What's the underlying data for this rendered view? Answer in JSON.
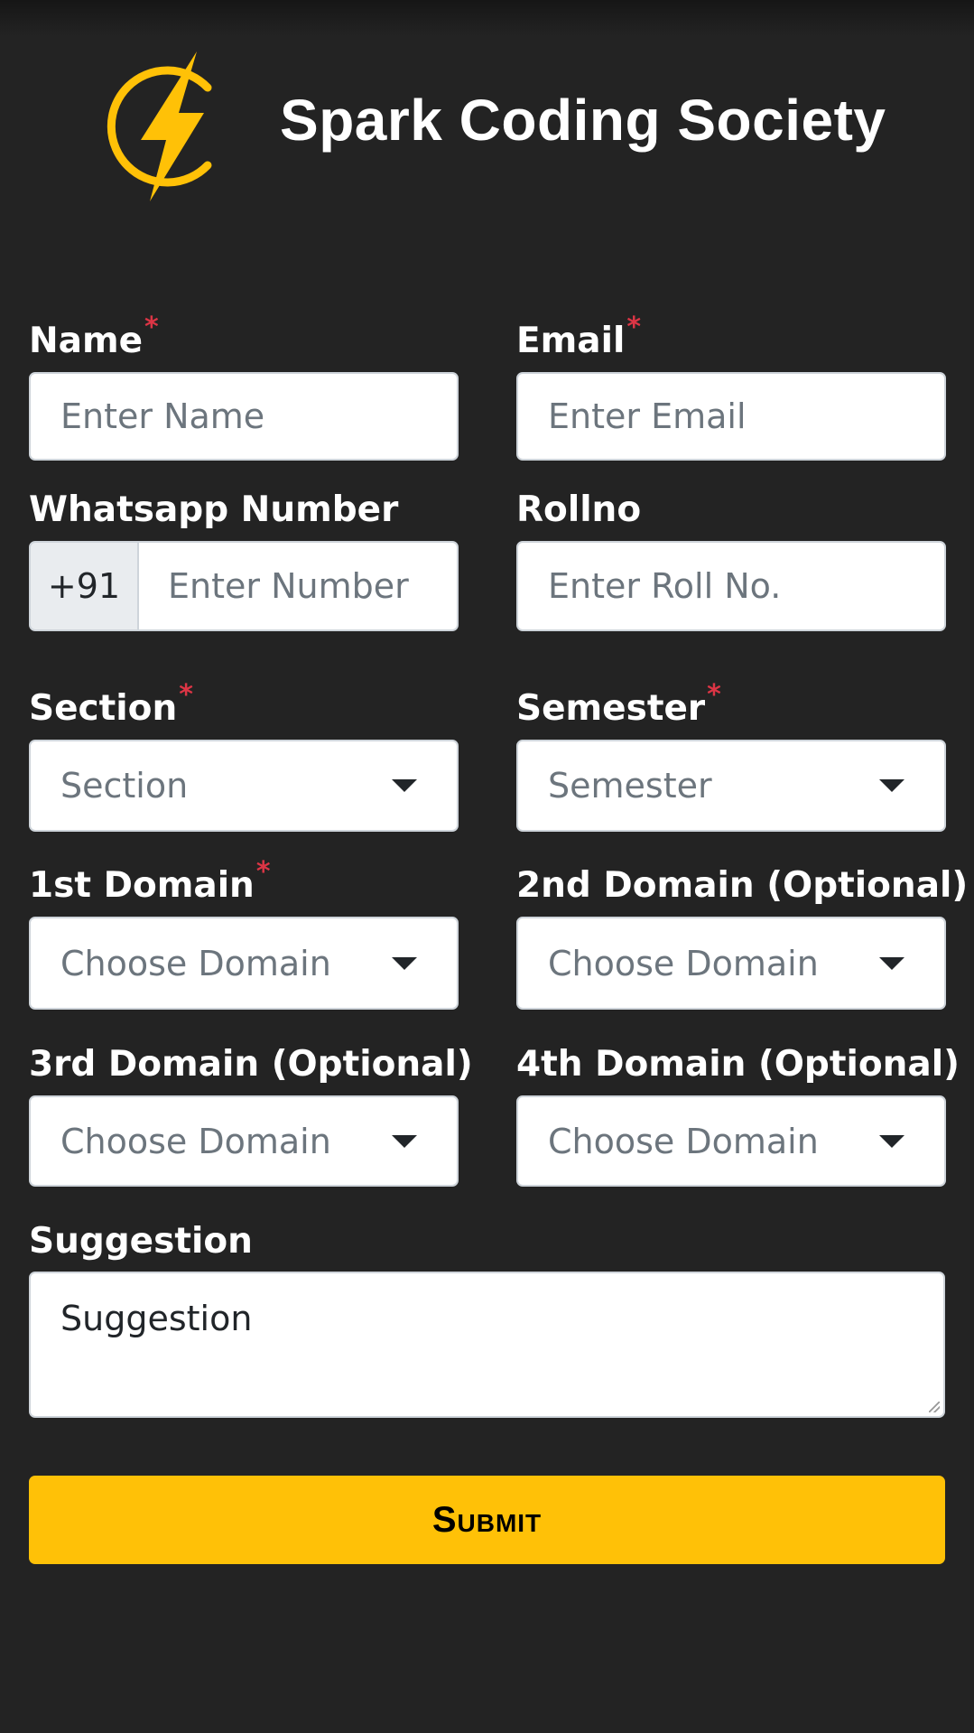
{
  "header": {
    "brand": "Spark Coding Society",
    "logo_icon": "lightning-bolt-logo-icon",
    "accent_color": "#ffc107"
  },
  "form": {
    "required_marker": "*",
    "name": {
      "label": "Name",
      "placeholder": "Enter Name"
    },
    "email": {
      "label": "Email",
      "placeholder": "Enter Email"
    },
    "whatsapp": {
      "label": "Whatsapp Number",
      "prefix": "+91",
      "placeholder": "Enter Number"
    },
    "rollno": {
      "label": "Rollno",
      "placeholder": "Enter Roll No."
    },
    "section": {
      "label": "Section",
      "selected": "Section"
    },
    "semester": {
      "label": "Semester",
      "selected": "Semester"
    },
    "domain1": {
      "label": "1st Domain",
      "selected": "Choose Domain"
    },
    "domain2": {
      "label": "2nd Domain (Optional)",
      "selected": "Choose Domain"
    },
    "domain3": {
      "label": "3rd Domain (Optional)",
      "selected": "Choose Domain"
    },
    "domain4": {
      "label": "4th Domain (Optional)",
      "selected": "Choose Domain"
    },
    "suggestion": {
      "label": "Suggestion",
      "placeholder": "Suggestion"
    },
    "submit_label": "Submit",
    "colors": {
      "required": "#dc3545",
      "background": "#232323",
      "submit": "#ffc107"
    }
  }
}
